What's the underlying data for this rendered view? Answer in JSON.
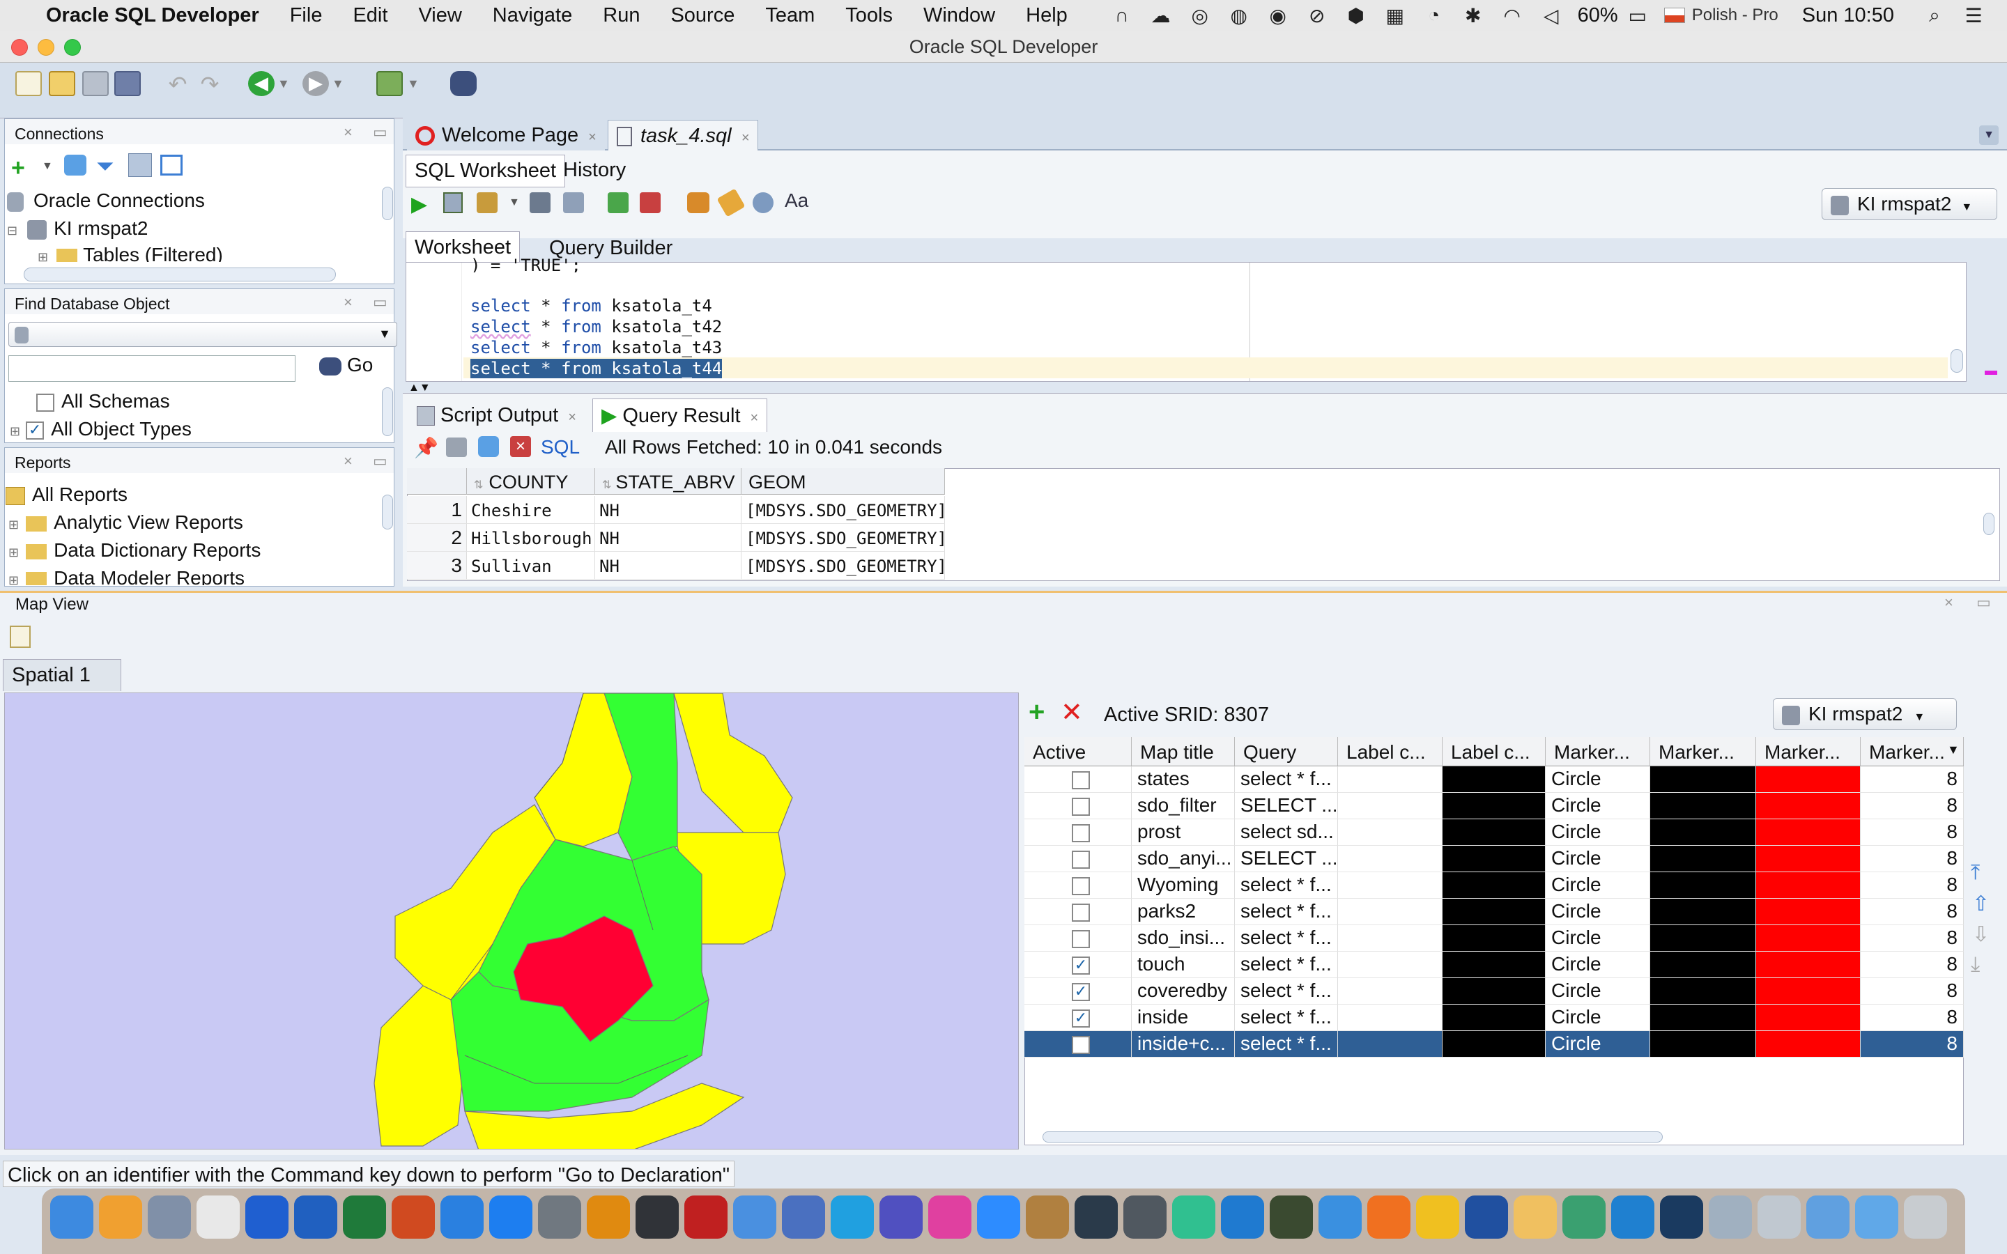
{
  "menubar": {
    "app": "Oracle SQL Developer",
    "items": [
      "File",
      "Edit",
      "View",
      "Navigate",
      "Run",
      "Source",
      "Team",
      "Tools",
      "Window",
      "Help"
    ],
    "battery": "60%",
    "input_source": "Polish - Pro",
    "clock": "Sun 10:50"
  },
  "window": {
    "title": "Oracle SQL Developer"
  },
  "connections": {
    "title": "Connections",
    "root": "Oracle Connections",
    "conn": "KI rmspat2",
    "child": "Tables (Filtered)"
  },
  "find_db": {
    "title": "Find Database Object",
    "go": "Go",
    "all_schemas": "All Schemas",
    "all_object_types": "All Object Types"
  },
  "reports": {
    "title": "Reports",
    "items": [
      "All Reports",
      "Analytic View Reports",
      "Data Dictionary Reports",
      "Data Modeler Reports"
    ]
  },
  "doc_tabs": {
    "welcome": "Welcome Page",
    "sql": "task_4.sql"
  },
  "worksheet": {
    "tab_sql": "SQL Worksheet",
    "tab_history": "History",
    "connection": "KI rmspat2",
    "sub_worksheet": "Worksheet",
    "sub_qb": "Query Builder",
    "lines": {
      "l0_tail": ") = 'TRUE';",
      "kw": "select",
      "op": " * ",
      "from": "from",
      "t1": " ksatola_t4",
      "t2": " ksatola_t42",
      "t3": " ksatola_t43",
      "t4": " ksatola_t44"
    }
  },
  "output": {
    "tab_script": "Script Output",
    "tab_result": "Query Result",
    "sql_label": "SQL",
    "status": "All Rows Fetched: 10 in 0.041 seconds",
    "columns": [
      "COUNTY",
      "STATE_ABRV",
      "GEOM"
    ],
    "rows": [
      {
        "n": "1",
        "county": "Cheshire",
        "state": "NH",
        "geom": "[MDSYS.SDO_GEOMETRY]"
      },
      {
        "n": "2",
        "county": "Hillsborough",
        "state": "NH",
        "geom": "[MDSYS.SDO_GEOMETRY]"
      },
      {
        "n": "3",
        "county": "Sullivan",
        "state": "NH",
        "geom": "[MDSYS.SDO_GEOMETRY]"
      }
    ]
  },
  "mapview": {
    "title": "Map View",
    "tab": "Spatial 1",
    "srid": "Active SRID: 8307",
    "connection": "KI rmspat2",
    "columns": [
      "Active",
      "Map title",
      "Query",
      "Label c...",
      "Label c...",
      "Marker...",
      "Marker...",
      "Marker...",
      "Marker..."
    ],
    "rows": [
      {
        "active": "",
        "title": "states",
        "query": "select * f...",
        "marker": "Circle",
        "size": "8"
      },
      {
        "active": "",
        "title": "sdo_filter",
        "query": "SELECT ...",
        "marker": "Circle",
        "size": "8"
      },
      {
        "active": "",
        "title": "prost",
        "query": "select sd...",
        "marker": "Circle",
        "size": "8"
      },
      {
        "active": "",
        "title": "sdo_anyi...",
        "query": "SELECT ...",
        "marker": "Circle",
        "size": "8"
      },
      {
        "active": "",
        "title": "Wyoming",
        "query": "select * f...",
        "marker": "Circle",
        "size": "8"
      },
      {
        "active": "",
        "title": "parks2",
        "query": "select * f...",
        "marker": "Circle",
        "size": "8"
      },
      {
        "active": "",
        "title": "sdo_insi...",
        "query": "select * f...",
        "marker": "Circle",
        "size": "8"
      },
      {
        "active": "✓",
        "title": "touch",
        "query": "select * f...",
        "marker": "Circle",
        "size": "8"
      },
      {
        "active": "✓",
        "title": "coveredby",
        "query": "select * f...",
        "marker": "Circle",
        "size": "8"
      },
      {
        "active": "✓",
        "title": "inside",
        "query": "select * f...",
        "marker": "Circle",
        "size": "8"
      },
      {
        "active": "",
        "title": "inside+c...",
        "query": "select * f...",
        "marker": "Circle",
        "size": "8"
      }
    ]
  },
  "statusbar": {
    "text": "Click on an identifier with the Command key down to perform \"Go to Declaration\""
  },
  "colors": {
    "map_bg": "#c9c9f4",
    "county_yellow": "#ffff00",
    "county_green": "#33ff33",
    "county_red": "#ff0033",
    "selection": "#2f5f95"
  }
}
